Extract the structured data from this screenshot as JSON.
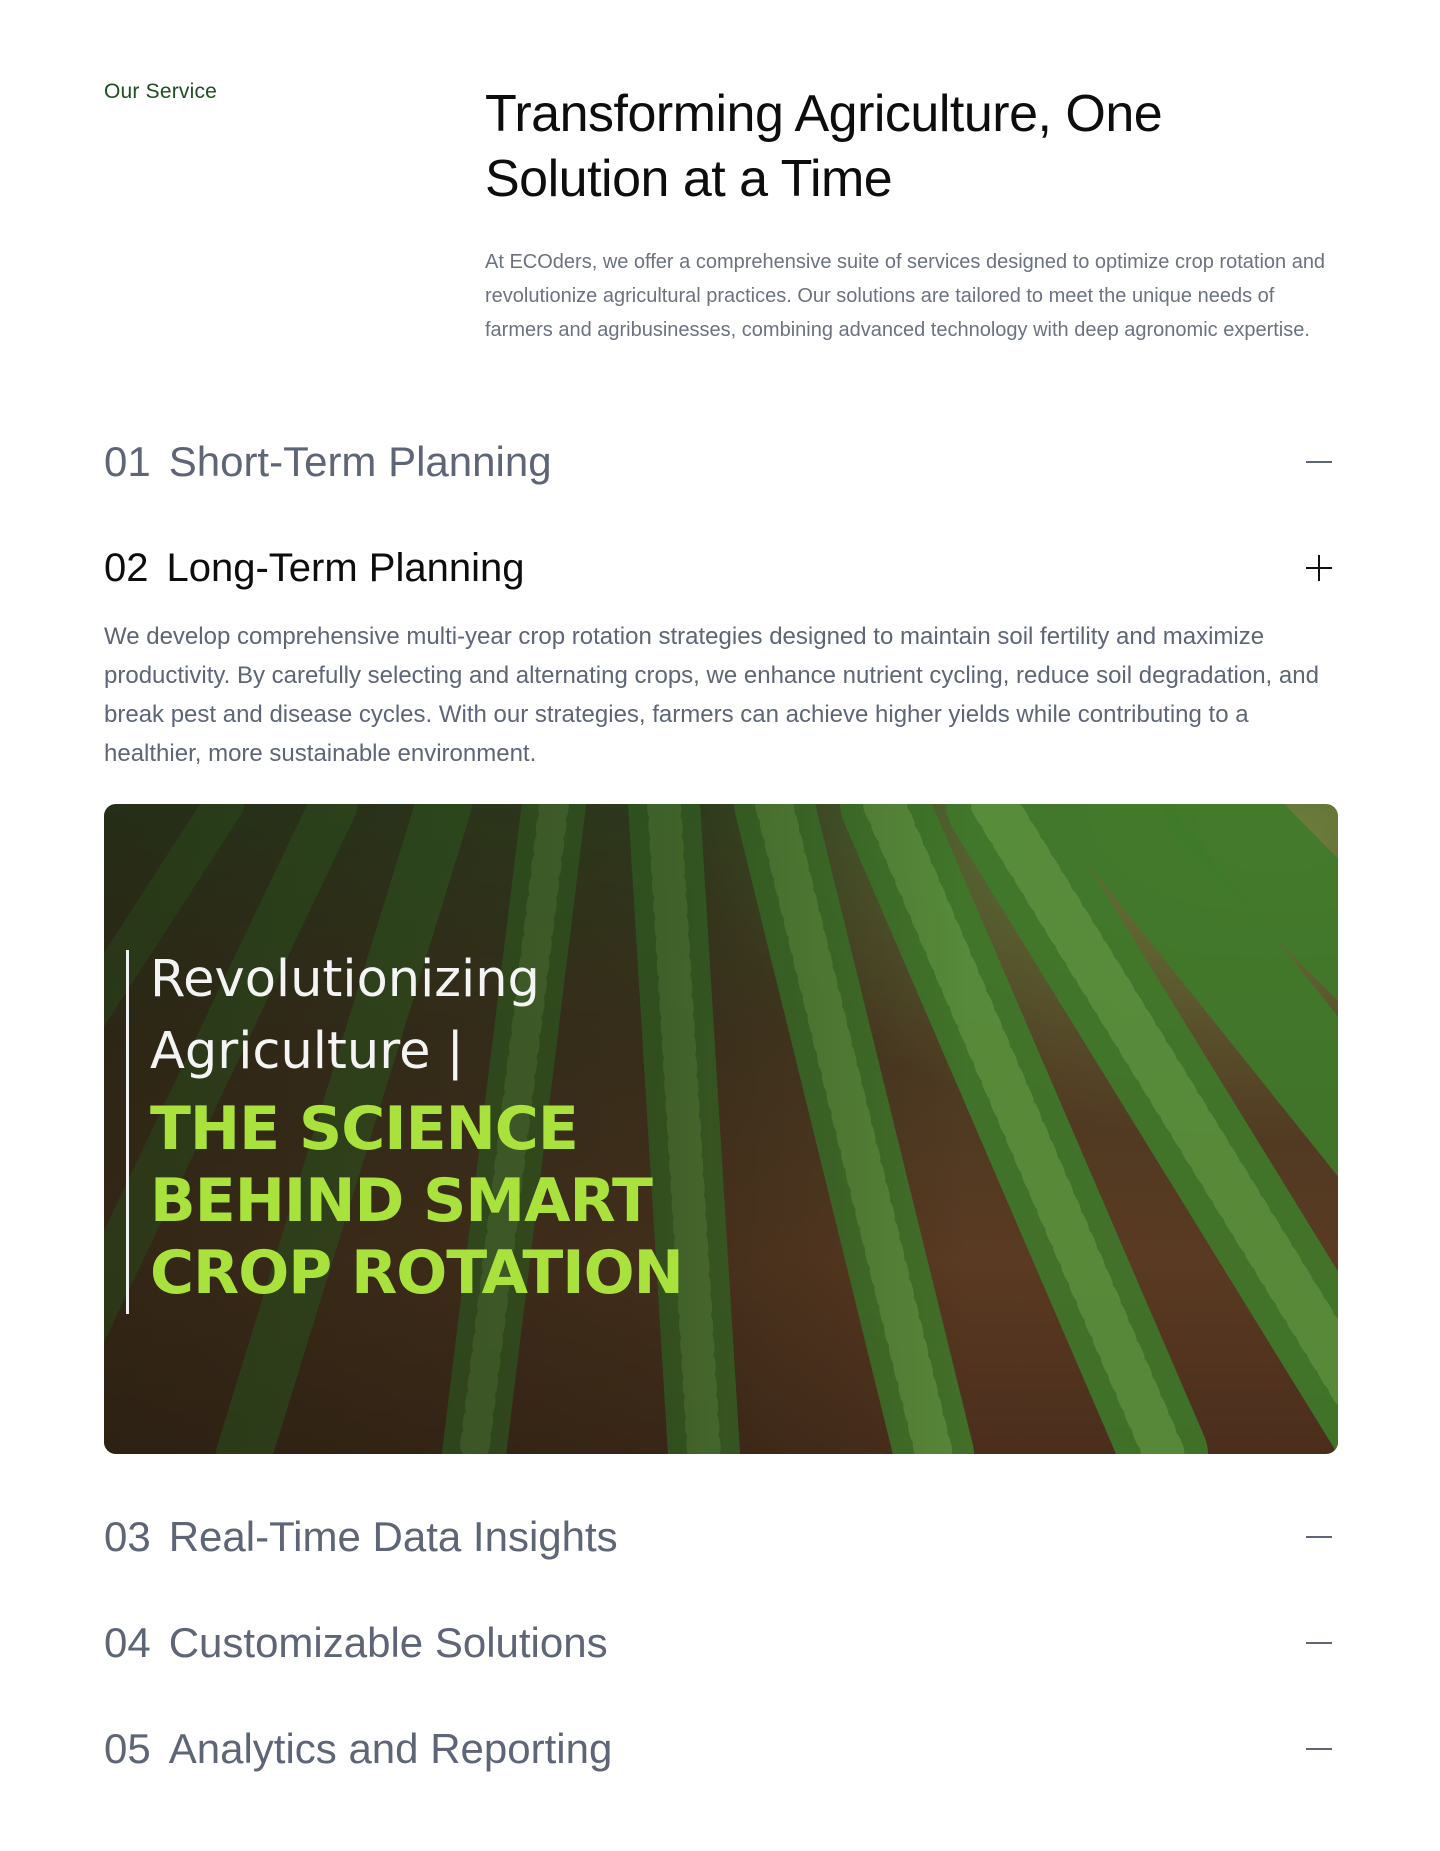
{
  "section": {
    "eyebrow": "Our Service",
    "headline_line1": "Transforming Agriculture, One",
    "headline_line2": "Solution at a Time",
    "intro": "At ECOders, we offer a comprehensive suite of services designed to optimize crop rotation and revolutionize agricultural practices. Our solutions are tailored to meet the unique needs of farmers and agribusinesses, combining advanced technology with deep agronomic expertise."
  },
  "accordion": {
    "items": [
      {
        "num": "01",
        "title": "Short-Term Planning",
        "icon": "minus-icon"
      },
      {
        "num": "02",
        "title": "Long-Term Planning",
        "icon": "plus-icon",
        "body": "We develop comprehensive multi-year crop rotation strategies designed to maintain soil fertility and maximize productivity. By carefully selecting and alternating crops, we enhance nutrient cycling, reduce soil degradation, and break pest and disease cycles. With our strategies, farmers can achieve higher yields while contributing to a healthier, more sustainable environment."
      },
      {
        "num": "03",
        "title": "Real-Time Data Insights",
        "icon": "minus-icon"
      },
      {
        "num": "04",
        "title": "Customizable Solutions",
        "icon": "minus-icon"
      },
      {
        "num": "05",
        "title": "Analytics and Reporting",
        "icon": "minus-icon"
      }
    ]
  },
  "hero_image": {
    "line1": "Revolutionizing",
    "line2": "Agriculture |",
    "big1": "THE SCIENCE",
    "big2": "BEHIND SMART",
    "big3": "CROP ROTATION",
    "accent": "#a9e23c"
  }
}
